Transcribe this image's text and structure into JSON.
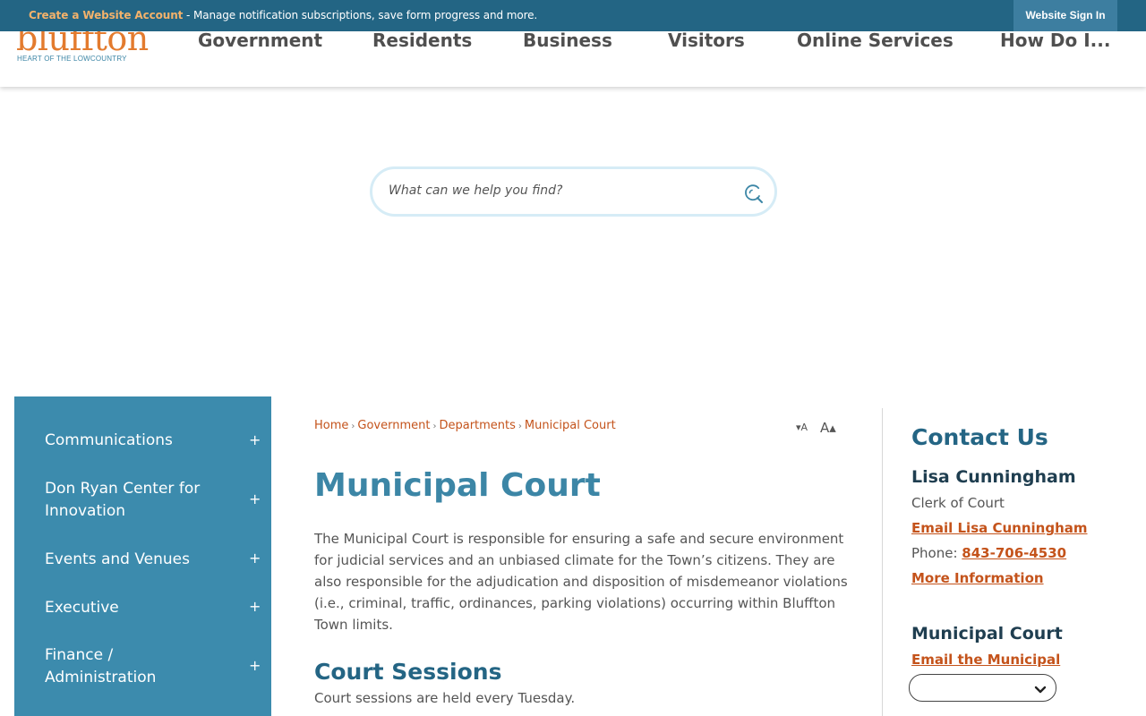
{
  "topbar": {
    "create_label": "Create a Website Account",
    "message": " - Manage notification subscriptions, save form progress and more.",
    "signin_label": "Website Sign In"
  },
  "logo": {
    "name": "bluffton",
    "tagline": "HEART OF THE LOWCOUNTRY"
  },
  "nav": {
    "items": [
      "Government",
      "Residents",
      "Business",
      "Visitors",
      "Online Services",
      "How Do I..."
    ]
  },
  "search": {
    "placeholder": "What can we help you find?",
    "icon": "search-icon"
  },
  "sidebar": {
    "items": [
      {
        "label": "Communications",
        "toggle": "+"
      },
      {
        "label": "Don Ryan Center for Innovation",
        "toggle": "+"
      },
      {
        "label": "Events and Venues",
        "toggle": "+"
      },
      {
        "label": "Executive",
        "toggle": "+"
      },
      {
        "label": "Finance / Administration",
        "toggle": "+"
      }
    ]
  },
  "breadcrumb": {
    "items": [
      "Home",
      "Government",
      "Departments",
      "Municipal Court"
    ],
    "separator": "›"
  },
  "font_tools": {
    "decrease": "▾A",
    "increase": "A▴"
  },
  "main": {
    "title": "Municipal Court",
    "intro": "The Municipal Court is responsible for ensuring a safe and secure environment for judicial services and an unbiased climate for the Town’s citizens. They are also responsible for the adjudication and disposition of misdemeanor violations (i.e., criminal, traffic, ordinances, parking violations) occurring within Bluffton Town limits.",
    "section_title": "Court Sessions",
    "section_text": "Court sessions are held every Tuesday."
  },
  "contact": {
    "title": "Contact Us",
    "name": "Lisa Cunningham",
    "role": "Clerk of Court",
    "email_label": "Email Lisa Cunningham",
    "phone_label": "Phone: ",
    "phone": "843-706-4530",
    "more_label": "More Information",
    "court_title": "Municipal Court",
    "court_email_label": "Email the Municipal"
  },
  "colors": {
    "topbar": "#236584",
    "accent_orange": "#c4531b",
    "sidebar": "#3c8bad",
    "heading_blue": "#3c86a6"
  }
}
